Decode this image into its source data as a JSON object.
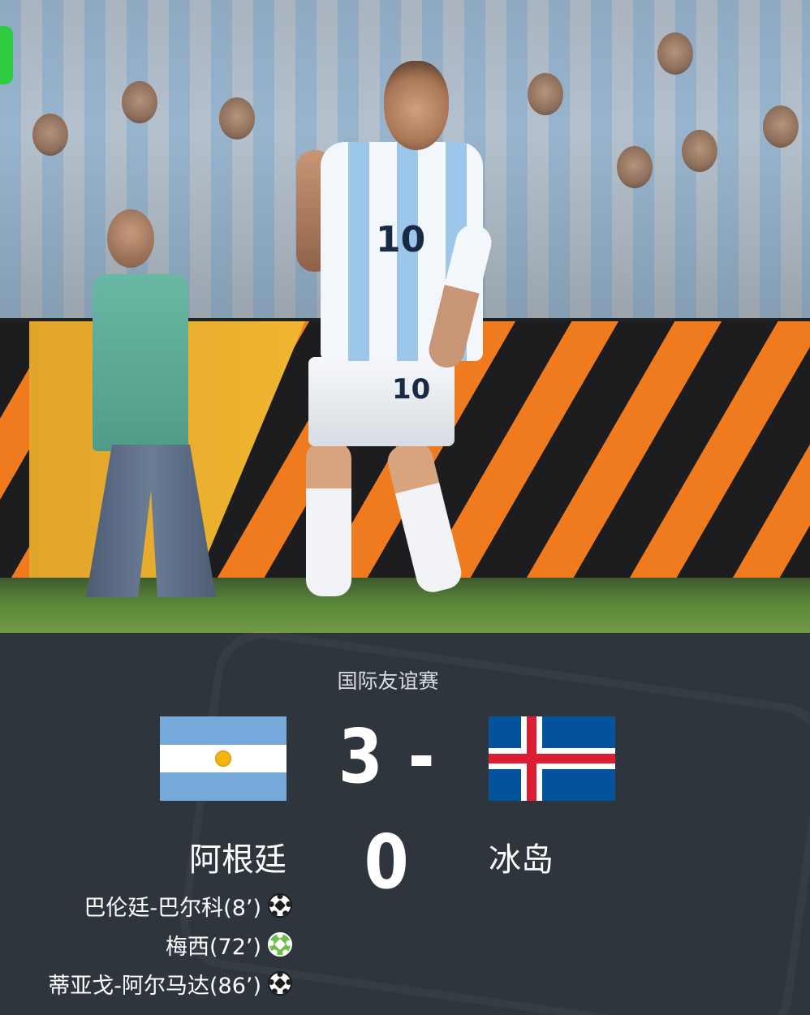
{
  "match": {
    "competition": "国际友谊赛",
    "score": "3 - 0",
    "home": {
      "name": "阿根廷",
      "flag_icon": "argentina-flag-icon",
      "flag_colors": {
        "sky": "#75aadb",
        "white": "#ffffff",
        "sun": "#f6b40e"
      }
    },
    "away": {
      "name": "冰岛",
      "flag_icon": "iceland-flag-icon",
      "flag_colors": {
        "blue": "#02529c",
        "white": "#ffffff",
        "red": "#dc1e35"
      }
    },
    "scorers": [
      {
        "text": "巴伦廷-巴尔科(8’)",
        "icon": "soccer-ball-icon",
        "icon_color": "#ffffff"
      },
      {
        "text": "梅西(72’)",
        "icon": "penalty-soccer-ball-icon",
        "icon_color": "#6cc04a"
      },
      {
        "text": "蒂亚戈-阿尔马达(86’)",
        "icon": "soccer-ball-icon",
        "icon_color": "#ffffff"
      }
    ]
  },
  "photo": {
    "subject": "player-celebration-photo",
    "shirt_number": "10",
    "shorts_number": "10"
  },
  "colors": {
    "panel_background": "#2f353d",
    "text_primary": "#ffffff",
    "text_secondary": "#d8dce2",
    "status_chip": "#2ecc40"
  }
}
